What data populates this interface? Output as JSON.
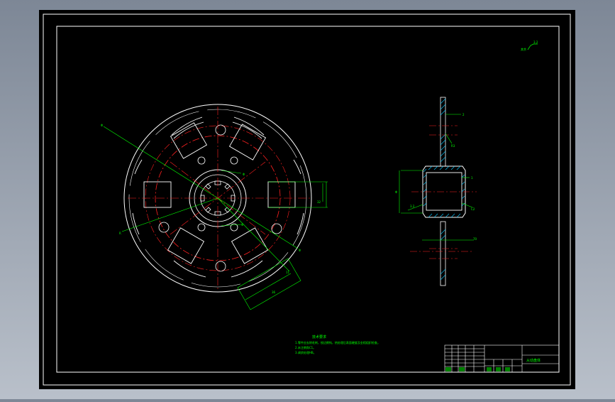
{
  "drawing": {
    "title_block_name": "从动盘体",
    "notes_title": "技术要求",
    "notes": [
      "1.零件应去除毛刺，锐边倒钝，热处理后表面硬度及金相组织检查。",
      "2.未注倒角C1。",
      "3.调质处理HB。"
    ]
  },
  "colors": {
    "background": "#000000",
    "frame": "#ffffff",
    "center_line": "#ff2020",
    "dimension": "#00ff00",
    "section_hatch": "#00c8ff",
    "title_text": "#00ff00"
  }
}
